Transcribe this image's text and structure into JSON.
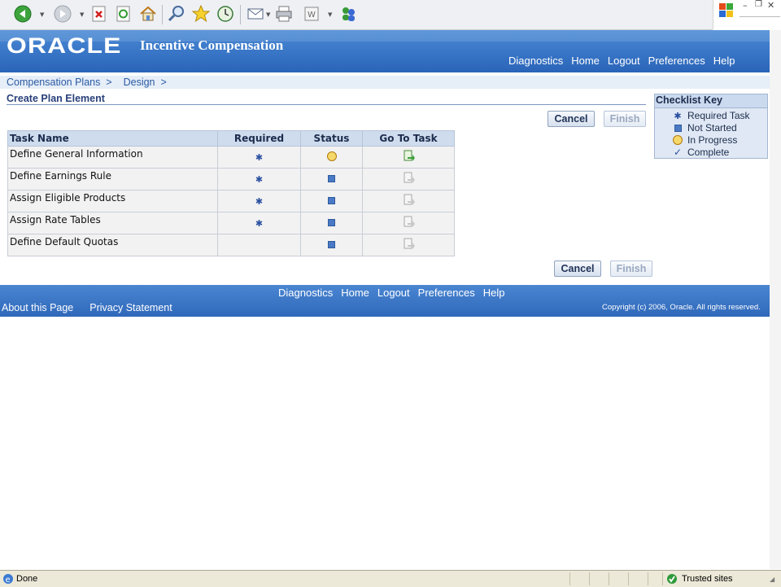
{
  "browser": {
    "status_text": "Done",
    "zone_text": "Trusted sites",
    "toolbar_icons": [
      "back-icon",
      "forward-icon",
      "stop-icon",
      "refresh-icon",
      "home-icon",
      "search-icon",
      "favorites-icon",
      "history-icon",
      "mail-icon",
      "print-icon",
      "edit-icon",
      "messenger-icon"
    ]
  },
  "header": {
    "logo_text": "ORACLE",
    "app_title": "Incentive Compensation",
    "global_links": [
      "Diagnostics",
      "Home",
      "Logout",
      "Preferences",
      "Help"
    ]
  },
  "breadcrumbs": [
    "Compensation Plans  >",
    "Design  >"
  ],
  "page_title": "Create Plan Element",
  "buttons": {
    "cancel": "Cancel",
    "finish": "Finish"
  },
  "table": {
    "headers": [
      "Task Name",
      "Required",
      "Status",
      "Go To Task"
    ],
    "rows": [
      {
        "task": "Define General Information",
        "required": true,
        "status": "in-progress",
        "goto_active": true
      },
      {
        "task": "Define Earnings Rule",
        "required": true,
        "status": "not-started",
        "goto_active": false
      },
      {
        "task": "Assign Eligible Products",
        "required": true,
        "status": "not-started",
        "goto_active": false
      },
      {
        "task": "Assign Rate Tables",
        "required": true,
        "status": "not-started",
        "goto_active": false
      },
      {
        "task": "Define Default Quotas",
        "required": false,
        "status": "not-started",
        "goto_active": false
      }
    ]
  },
  "checklist_key": {
    "title": "Checklist Key",
    "items": [
      {
        "label": "Required Task",
        "icon": "required-star-icon"
      },
      {
        "label": "Not Started",
        "icon": "not-started-icon"
      },
      {
        "label": "In Progress",
        "icon": "in-progress-icon"
      },
      {
        "label": "Complete",
        "icon": "complete-check-icon"
      }
    ]
  },
  "footer": {
    "links": [
      "Diagnostics",
      "Home",
      "Logout",
      "Preferences",
      "Help"
    ],
    "about": "About this Page",
    "privacy": "Privacy Statement",
    "copyright": "Copyright (c) 2006, Oracle. All rights reserved."
  },
  "colors": {
    "brand_blue": "#2a64b8",
    "link_blue": "#2a5aa2"
  }
}
